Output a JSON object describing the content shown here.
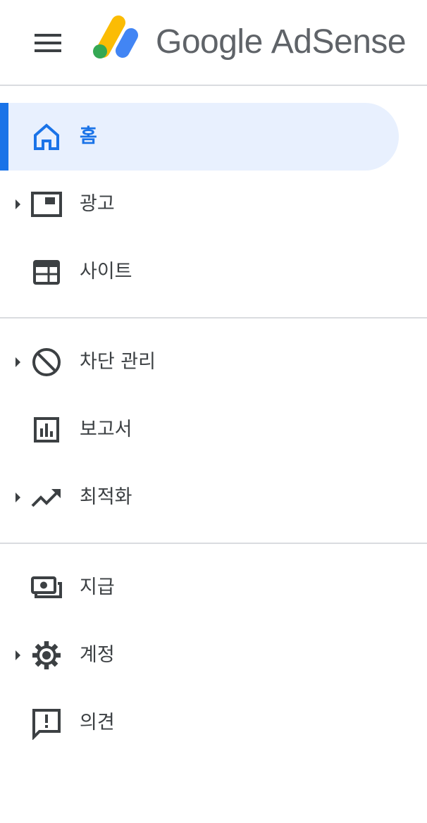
{
  "header": {
    "brand": "Google",
    "product": "AdSense",
    "menu_icon": "hamburger-menu-icon",
    "logo_icon": "adsense-logo-icon"
  },
  "colors": {
    "accent": "#1a73e8",
    "active_bg": "#e8f0fe",
    "icon": "#3c4043",
    "divider": "#dadce0",
    "logo_yellow": "#fbbc04",
    "logo_blue": "#4285f4",
    "logo_green": "#34a853"
  },
  "nav": {
    "home": {
      "label": "홈",
      "icon": "home-icon",
      "active": true
    },
    "ads": {
      "label": "광고",
      "icon": "ad-units-icon",
      "expandable": true
    },
    "sites": {
      "label": "사이트",
      "icon": "web-layout-icon"
    },
    "blocking": {
      "label": "차단 관리",
      "icon": "block-icon",
      "expandable": true
    },
    "reports": {
      "label": "보고서",
      "icon": "bar-chart-icon"
    },
    "optimization": {
      "label": "최적화",
      "icon": "trending-up-icon",
      "expandable": true
    },
    "payments": {
      "label": "지급",
      "icon": "payments-icon"
    },
    "account": {
      "label": "계정",
      "icon": "gear-icon",
      "expandable": true
    },
    "feedback": {
      "label": "의견",
      "icon": "feedback-icon"
    }
  }
}
